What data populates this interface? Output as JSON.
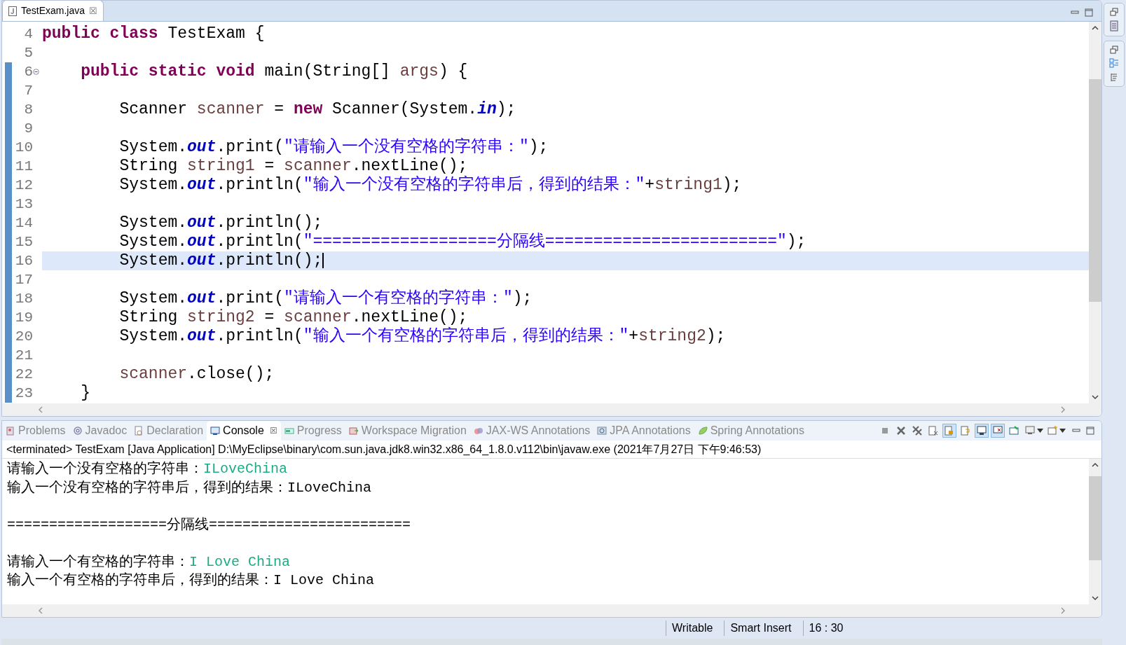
{
  "editor": {
    "tab": {
      "title": "TestExam.java",
      "close": "☒"
    },
    "lines": [
      {
        "number": "4",
        "current": false,
        "fold": false,
        "changed": false,
        "tokens": [
          {
            "kind": "keyword",
            "text": "public class "
          },
          {
            "kind": "plain",
            "text": "TestExam {"
          }
        ]
      },
      {
        "number": "5",
        "current": false,
        "fold": false,
        "changed": false
      },
      {
        "number": "6",
        "current": false,
        "fold": true,
        "changed": true,
        "tokens": [
          {
            "kind": "keyword",
            "text": "    public static void "
          },
          {
            "kind": "plain",
            "text": "main(String[] "
          },
          {
            "kind": "local",
            "text": "args"
          },
          {
            "kind": "plain",
            "text": ") {"
          }
        ]
      },
      {
        "number": "7",
        "current": false,
        "fold": false,
        "changed": true
      },
      {
        "number": "8",
        "current": false,
        "fold": false,
        "changed": true,
        "tokens": [
          {
            "kind": "plain",
            "text": "        Scanner "
          },
          {
            "kind": "local",
            "text": "scanner"
          },
          {
            "kind": "plain",
            "text": " = "
          },
          {
            "kind": "keyword",
            "text": "new "
          },
          {
            "kind": "plain",
            "text": "Scanner(System."
          },
          {
            "kind": "field",
            "text": "in"
          },
          {
            "kind": "plain",
            "text": ");"
          }
        ]
      },
      {
        "number": "9",
        "current": false,
        "fold": false,
        "changed": true
      },
      {
        "number": "10",
        "current": false,
        "fold": false,
        "changed": true,
        "tokens": [
          {
            "kind": "plain",
            "text": "        System."
          },
          {
            "kind": "field",
            "text": "out"
          },
          {
            "kind": "plain",
            "text": ".print("
          },
          {
            "kind": "string",
            "text": "\"请输入一个没有空格的字符串：\""
          },
          {
            "kind": "plain",
            "text": ");"
          }
        ]
      },
      {
        "number": "11",
        "current": false,
        "fold": false,
        "changed": true,
        "tokens": [
          {
            "kind": "plain",
            "text": "        String "
          },
          {
            "kind": "local",
            "text": "string1"
          },
          {
            "kind": "plain",
            "text": " = "
          },
          {
            "kind": "local",
            "text": "scanner"
          },
          {
            "kind": "plain",
            "text": ".nextLine();"
          }
        ]
      },
      {
        "number": "12",
        "current": false,
        "fold": false,
        "changed": true,
        "tokens": [
          {
            "kind": "plain",
            "text": "        System."
          },
          {
            "kind": "field",
            "text": "out"
          },
          {
            "kind": "plain",
            "text": ".println("
          },
          {
            "kind": "string",
            "text": "\"输入一个没有空格的字符串后，得到的结果：\""
          },
          {
            "kind": "plain",
            "text": "+"
          },
          {
            "kind": "local",
            "text": "string1"
          },
          {
            "kind": "plain",
            "text": ");"
          }
        ]
      },
      {
        "number": "13",
        "current": false,
        "fold": false,
        "changed": true
      },
      {
        "number": "14",
        "current": false,
        "fold": false,
        "changed": true,
        "tokens": [
          {
            "kind": "plain",
            "text": "        System."
          },
          {
            "kind": "field",
            "text": "out"
          },
          {
            "kind": "plain",
            "text": ".println();"
          }
        ]
      },
      {
        "number": "15",
        "current": false,
        "fold": false,
        "changed": true,
        "tokens": [
          {
            "kind": "plain",
            "text": "        System."
          },
          {
            "kind": "field",
            "text": "out"
          },
          {
            "kind": "plain",
            "text": ".println("
          },
          {
            "kind": "string",
            "text": "\"===================分隔线========================\""
          },
          {
            "kind": "plain",
            "text": ");"
          }
        ]
      },
      {
        "number": "16",
        "current": true,
        "fold": false,
        "changed": true,
        "tokens": [
          {
            "kind": "plain",
            "text": "        System."
          },
          {
            "kind": "field",
            "text": "out"
          },
          {
            "kind": "plain",
            "text": ".println();"
          }
        ]
      },
      {
        "number": "17",
        "current": false,
        "fold": false,
        "changed": true
      },
      {
        "number": "18",
        "current": false,
        "fold": false,
        "changed": true,
        "tokens": [
          {
            "kind": "plain",
            "text": "        System."
          },
          {
            "kind": "field",
            "text": "out"
          },
          {
            "kind": "plain",
            "text": ".print("
          },
          {
            "kind": "string",
            "text": "\"请输入一个有空格的字符串：\""
          },
          {
            "kind": "plain",
            "text": ");"
          }
        ]
      },
      {
        "number": "19",
        "current": false,
        "fold": false,
        "changed": true,
        "tokens": [
          {
            "kind": "plain",
            "text": "        String "
          },
          {
            "kind": "local",
            "text": "string2"
          },
          {
            "kind": "plain",
            "text": " = "
          },
          {
            "kind": "local",
            "text": "scanner"
          },
          {
            "kind": "plain",
            "text": ".nextLine();"
          }
        ]
      },
      {
        "number": "20",
        "current": false,
        "fold": false,
        "changed": true,
        "tokens": [
          {
            "kind": "plain",
            "text": "        System."
          },
          {
            "kind": "field",
            "text": "out"
          },
          {
            "kind": "plain",
            "text": ".println("
          },
          {
            "kind": "string",
            "text": "\"输入一个有空格的字符串后，得到的结果：\""
          },
          {
            "kind": "plain",
            "text": "+"
          },
          {
            "kind": "local",
            "text": "string2"
          },
          {
            "kind": "plain",
            "text": ");"
          }
        ]
      },
      {
        "number": "21",
        "current": false,
        "fold": false,
        "changed": true
      },
      {
        "number": "22",
        "current": false,
        "fold": false,
        "changed": true,
        "tokens": [
          {
            "kind": "local",
            "text": "        scanner"
          },
          {
            "kind": "plain",
            "text": ".close();"
          }
        ]
      },
      {
        "number": "23",
        "current": false,
        "fold": false,
        "changed": true,
        "tokens": [
          {
            "kind": "plain",
            "text": "    }"
          }
        ]
      }
    ]
  },
  "views": {
    "tabs": [
      {
        "label": "Problems",
        "selected": false
      },
      {
        "label": "Javadoc",
        "selected": false
      },
      {
        "label": "Declaration",
        "selected": false
      },
      {
        "label": "Console",
        "selected": true,
        "close": "☒"
      },
      {
        "label": "Progress",
        "selected": false
      },
      {
        "label": "Workspace Migration",
        "selected": false
      },
      {
        "label": "JAX-WS Annotations",
        "selected": false
      },
      {
        "label": "JPA Annotations",
        "selected": false
      },
      {
        "label": "Spring Annotations",
        "selected": false
      }
    ],
    "toolbar": [
      {
        "kind": "stop",
        "pressed": false
      },
      {
        "kind": "remove",
        "pressed": false
      },
      {
        "kind": "remove-all",
        "pressed": false
      },
      {
        "kind": "clear",
        "pressed": false
      },
      {
        "kind": "lock",
        "pressed": true
      },
      {
        "kind": "wrap",
        "pressed": false
      },
      {
        "kind": "show-out",
        "pressed": true
      },
      {
        "kind": "show-err",
        "pressed": true
      },
      {
        "kind": "pin",
        "pressed": false
      },
      {
        "kind": "display",
        "pressed": false
      },
      {
        "kind": "new",
        "pressed": false
      }
    ]
  },
  "console": {
    "header": "<terminated> TestExam [Java Application] D:\\MyEclipse\\binary\\com.sun.java.jdk8.win32.x86_64_1.8.0.v112\\bin\\javaw.exe (2021年7月27日 下午9:46:53)",
    "lines": [
      {
        "segments": [
          {
            "kind": "output",
            "text": "请输入一个没有空格的字符串："
          },
          {
            "kind": "input",
            "text": "ILoveChina"
          }
        ]
      },
      {
        "segments": [
          {
            "kind": "output",
            "text": "输入一个没有空格的字符串后，得到的结果：ILoveChina"
          }
        ]
      },
      {
        "gap_before": true,
        "segments": [
          {
            "kind": "output",
            "text": "===================分隔线========================"
          }
        ]
      },
      {
        "gap_before": true,
        "segments": [
          {
            "kind": "output",
            "text": "请输入一个有空格的字符串："
          },
          {
            "kind": "input",
            "text": "I Love China"
          }
        ]
      },
      {
        "segments": [
          {
            "kind": "output",
            "text": "输入一个有空格的字符串后，得到的结果：I Love China"
          }
        ]
      }
    ]
  },
  "status_bar": [
    "Writable",
    "Smart Insert",
    "16 : 30"
  ]
}
